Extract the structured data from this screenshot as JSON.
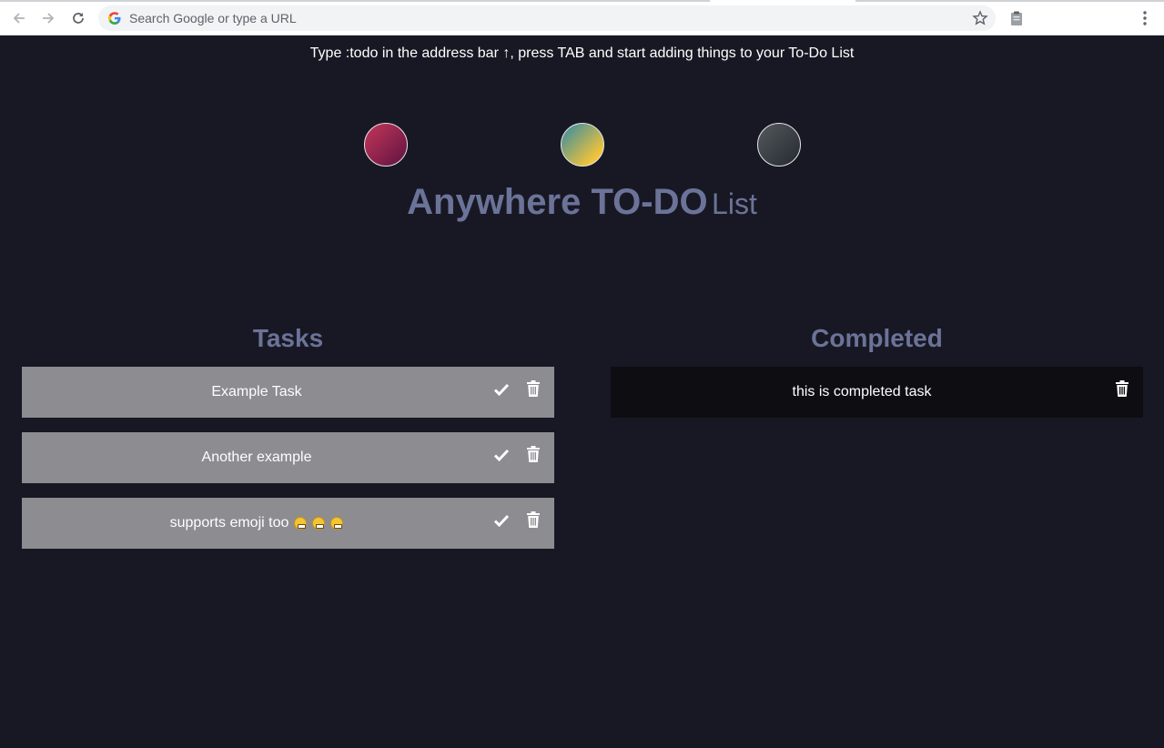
{
  "browser": {
    "omnibox_placeholder": "Search Google or type a URL"
  },
  "page": {
    "hint": "Type :todo in the address bar ↑, press TAB and start adding things to your To-Do List",
    "title_main": "Anywhere TO-DO",
    "title_sub": "List",
    "themes": [
      {
        "name": "crimson",
        "color_from": "#c5365a",
        "color_to": "#5d1340"
      },
      {
        "name": "blue-yellow",
        "color_from": "#2f8aa7",
        "color_to": "#f1c33a"
      },
      {
        "name": "charcoal",
        "color_from": "#55595e",
        "color_to": "#242a30"
      }
    ],
    "colors": {
      "background": "#181824",
      "heading": "#6b7398",
      "task_bg": "#8c8c91",
      "completed_bg": "#0d0d12"
    }
  },
  "tasks": {
    "heading": "Tasks",
    "items": [
      {
        "text": "Example Task"
      },
      {
        "text": "Another example"
      },
      {
        "text": "supports emoji too",
        "emoji": [
          "grimacing-face",
          "grinning-squinting-face",
          "smiling-face-with-sweat"
        ]
      }
    ]
  },
  "completed": {
    "heading": "Completed",
    "items": [
      {
        "text": "this is completed task"
      }
    ]
  }
}
